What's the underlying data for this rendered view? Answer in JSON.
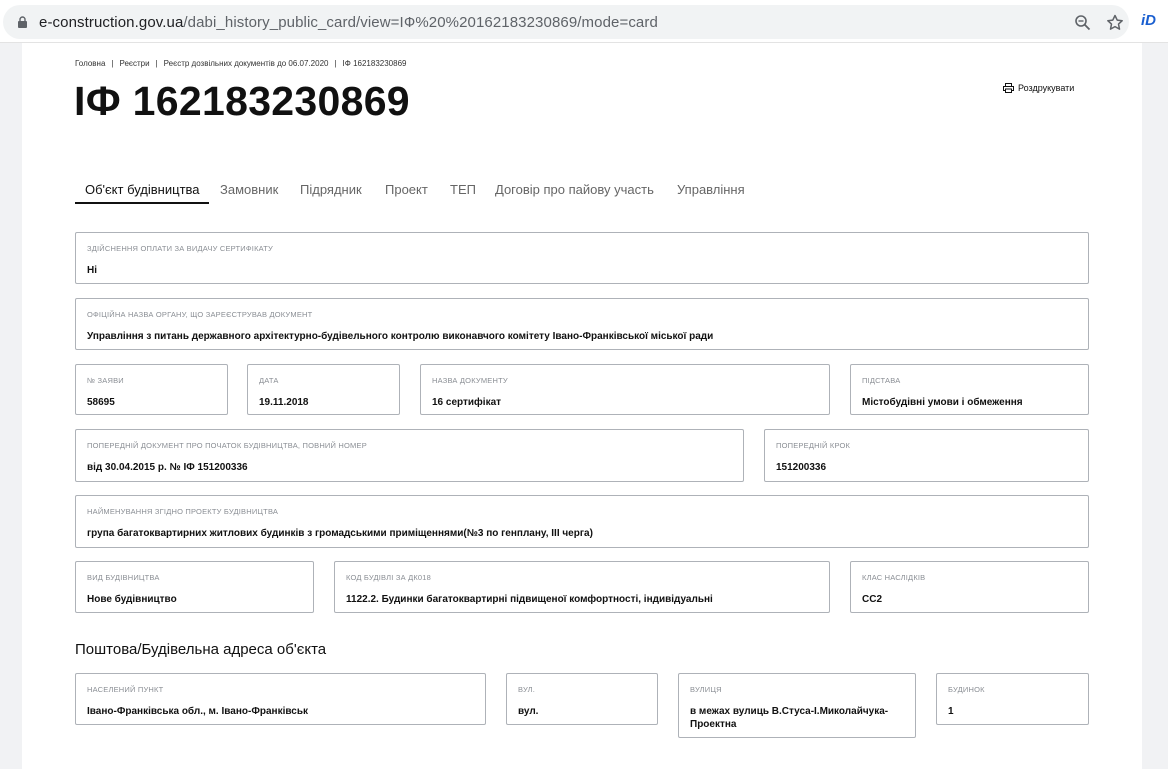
{
  "browser": {
    "host": "e-construction.gov.ua",
    "path": "/dabi_history_public_card/view=IФ%20%20162183230869/mode=card",
    "extension_label": "iD"
  },
  "breadcrumb": [
    "Головна",
    "Реєстри",
    "Реєстр дозвільних документів до 06.07.2020",
    "IФ 162183230869"
  ],
  "page_title": "IФ 162183230869",
  "print_label": "Роздрукувати",
  "tabs": [
    {
      "label": "Об'єкт будівництва",
      "active": true
    },
    {
      "label": "Замовник"
    },
    {
      "label": "Підрядник"
    },
    {
      "label": "Проект"
    },
    {
      "label": "ТЕП"
    },
    {
      "label": "Договір про пайову участь"
    },
    {
      "label": "Управління"
    }
  ],
  "fields": {
    "payment": {
      "label": "Здійснення оплати за видачу сертифікату",
      "value": "Ні"
    },
    "authority": {
      "label": "Офіційна назва органу, що зареєстрував документ",
      "value": "Управління з питань державного архітектурно-будівельного контролю виконавчого комітету Івано-Франківської міської ради"
    },
    "application_no": {
      "label": "№ заяви",
      "value": "58695"
    },
    "date": {
      "label": "Дата",
      "value": "19.11.2018"
    },
    "doc_name": {
      "label": "Назва документу",
      "value": "16 сертифікат"
    },
    "basis": {
      "label": "Підстава",
      "value": "Містобудівні умови і обмеження"
    },
    "prev_doc": {
      "label": "Попередній документ про початок будівництва, повний номер",
      "value": "від 30.04.2015 р. № IФ 151200336"
    },
    "prev_step": {
      "label": "Попередній крок",
      "value": "151200336"
    },
    "project_name": {
      "label": "Найменування згідно проекту будівництва",
      "value": "група багатоквартирних житлових будинків з громадськими приміщеннями(№3 по генплану, III черга)"
    },
    "construction_type": {
      "label": "Вид будівництва",
      "value": "Нове будівництво"
    },
    "building_code": {
      "label": "Код будівлі за ДК018",
      "value": "1122.2. Будинки багатоквартирні підвищеної комфортності, індивідуальні"
    },
    "consequence_class": {
      "label": "Клас наслідків",
      "value": "СС2"
    }
  },
  "address_section_title": "Поштова/Будівельна адреса об'єкта",
  "address": {
    "settlement": {
      "label": "Населений пункт",
      "value": "Івано-Франківська обл., м. Івано-Франківськ"
    },
    "street_type": {
      "label": "Вул.",
      "value": "вул."
    },
    "street": {
      "label": "Вулиця",
      "value": "в межах вулиць В.Стуса-І.Миколайчука-Проектна"
    },
    "building": {
      "label": "Будинок",
      "value": "1"
    }
  }
}
